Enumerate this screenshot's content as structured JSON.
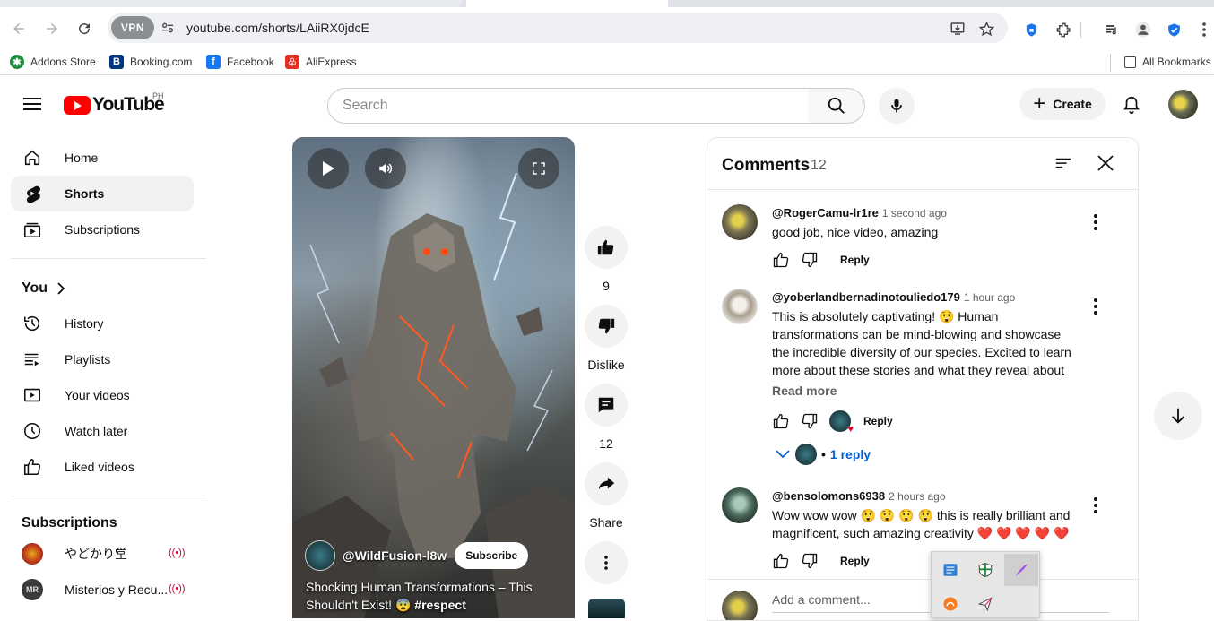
{
  "browser": {
    "url": "youtube.com/shorts/LAiiRX0jdcE",
    "vpn_label": "VPN",
    "bookmarks": [
      {
        "label": "Addons Store",
        "icon": "addons-store-icon",
        "color": "#1e8e3e"
      },
      {
        "label": "Booking.com",
        "icon": "booking-icon",
        "color": "#003580"
      },
      {
        "label": "Facebook",
        "icon": "facebook-icon",
        "color": "#1877f2"
      },
      {
        "label": "AliExpress",
        "icon": "aliexpress-icon",
        "color": "#e43225"
      }
    ],
    "all_bookmarks": "All Bookmarks"
  },
  "yt_header": {
    "logo_text": "YouTube",
    "country_code": "PH",
    "search_placeholder": "Search",
    "create_label": "Create"
  },
  "sidebar": {
    "main": [
      {
        "label": "Home",
        "icon": "home-icon"
      },
      {
        "label": "Shorts",
        "icon": "shorts-icon",
        "active": true
      },
      {
        "label": "Subscriptions",
        "icon": "subscriptions-icon"
      }
    ],
    "you_heading": "You",
    "you_items": [
      {
        "label": "History",
        "icon": "history-icon"
      },
      {
        "label": "Playlists",
        "icon": "playlists-icon"
      },
      {
        "label": "Your videos",
        "icon": "your-videos-icon"
      },
      {
        "label": "Watch later",
        "icon": "watch-later-icon"
      },
      {
        "label": "Liked videos",
        "icon": "liked-videos-icon"
      }
    ],
    "subs_heading": "Subscriptions",
    "subs": [
      {
        "label": "やどかり堂",
        "live": true
      },
      {
        "label": "Misterios y Recu...",
        "live": true
      }
    ]
  },
  "short": {
    "channel": "@WildFusion-l8w",
    "subscribe_label": "Subscribe",
    "title": "Shocking Human Transformations – This Shouldn't Exist! 😨",
    "hashtag": "#respect"
  },
  "actions": {
    "likes": "9",
    "dislike_label": "Dislike",
    "comments_count": "12",
    "share_label": "Share"
  },
  "comments_panel": {
    "title": "Comments",
    "count": "12",
    "reply_label": "Reply",
    "read_more": "Read more",
    "replies_label": "1 reply",
    "add_placeholder": "Add a comment...",
    "items": [
      {
        "author": "@RogerCamu-lr1re",
        "time": "1 second ago",
        "text": "good job, nice video, amazing"
      },
      {
        "author": "@yoberlandbernadinotouliedo179",
        "time": "1 hour ago",
        "text": "This is absolutely captivating! 😲 Human transformations can be mind-blowing and showcase the incredible diversity of our species. Excited to learn more about these stories and what they reveal about …"
      },
      {
        "author": "@bensolomons6938",
        "time": "2 hours ago",
        "text": "Wow wow wow 😲 😲 😲 😲  this is really brilliant and magnificent, such amazing creativity ❤️ ❤️ ❤️ ❤️ ❤️"
      }
    ]
  },
  "colors": {
    "yt_red": "#ff0000",
    "link_blue": "#065fd4",
    "live_red": "#cc0033"
  }
}
